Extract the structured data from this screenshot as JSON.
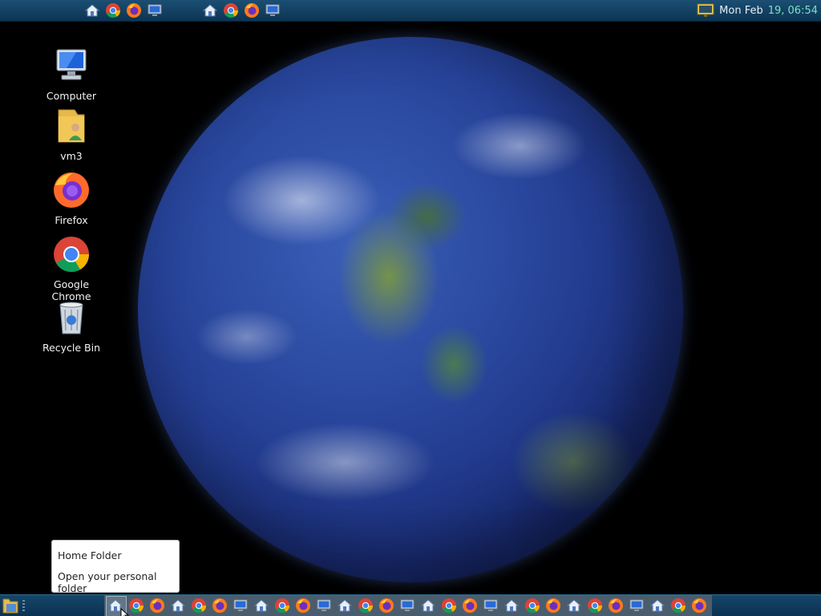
{
  "top_panel": {
    "clock": {
      "day": "Mon Feb",
      "time": "19, 06:54"
    },
    "launchers_group1": [
      "home-icon",
      "chrome-icon",
      "firefox-icon",
      "computer-icon"
    ],
    "launchers_group2": [
      "home-icon",
      "chrome-icon",
      "firefox-icon",
      "computer-icon"
    ]
  },
  "desktop": {
    "icons": [
      {
        "label": "Computer",
        "icon": "computer-icon"
      },
      {
        "label": "vm3",
        "icon": "user-folder-icon"
      },
      {
        "label": "Firefox",
        "icon": "firefox-icon"
      },
      {
        "label": "Google Chrome",
        "icon": "chrome-icon"
      },
      {
        "label": "Recycle Bin",
        "icon": "recycle-bin-icon"
      }
    ]
  },
  "tooltip": {
    "title": "Home Folder",
    "description": "Open your personal folder"
  },
  "taskbar": {
    "launcher_sequence": [
      "home",
      "chrome",
      "firefox",
      "home",
      "chrome",
      "firefox",
      "computer",
      "home",
      "chrome",
      "firefox",
      "computer",
      "home",
      "chrome",
      "firefox",
      "computer",
      "home",
      "chrome",
      "firefox",
      "computer",
      "home",
      "chrome",
      "firefox",
      "home",
      "chrome",
      "firefox",
      "computer",
      "home",
      "chrome",
      "firefox"
    ]
  },
  "colors": {
    "panel": "#0d3553",
    "clock_time": "#7ee0c5",
    "task_strip": "#4a5d6e"
  }
}
